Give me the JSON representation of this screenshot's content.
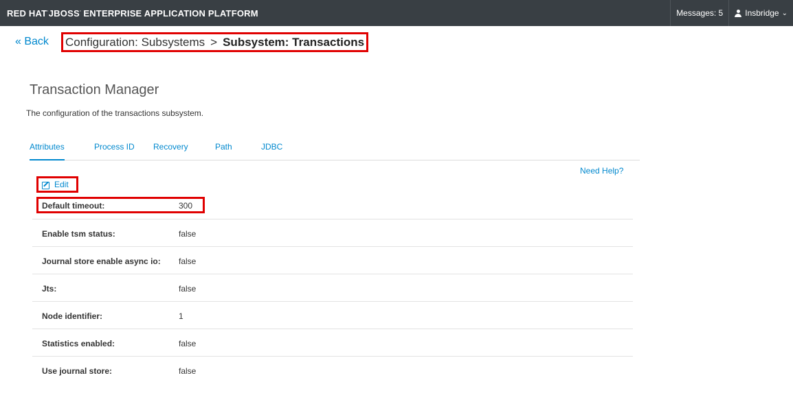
{
  "header": {
    "brand_redhat": "RED HAT",
    "brand_jboss": "JBOSS",
    "brand_rest": "ENTERPRISE APPLICATION PLATFORM",
    "messages": "Messages: 5",
    "user": "Insbridge",
    "user_icon": "user-icon",
    "chevron": "chevron-down-icon"
  },
  "nav": {
    "back": "« Back",
    "breadcrumb_parent": "Configuration: Subsystems",
    "breadcrumb_sep": ">",
    "breadcrumb_current": "Subsystem: Transactions"
  },
  "main": {
    "title": "Transaction Manager",
    "description": "The configuration of the transactions subsystem.",
    "tabs": [
      {
        "label": "Attributes",
        "active": true
      },
      {
        "label": "Process ID",
        "active": false
      },
      {
        "label": "Recovery",
        "active": false
      },
      {
        "label": "Path",
        "active": false
      },
      {
        "label": "JDBC",
        "active": false
      }
    ],
    "need_help": "Need Help?",
    "edit_label": "Edit",
    "edit_icon": "edit-icon",
    "attributes": [
      {
        "label": "Default timeout:",
        "value": "300"
      },
      {
        "label": "Enable tsm status:",
        "value": "false"
      },
      {
        "label": "Journal store enable async io:",
        "value": "false"
      },
      {
        "label": "Jts:",
        "value": "false"
      },
      {
        "label": "Node identifier:",
        "value": "1"
      },
      {
        "label": "Statistics enabled:",
        "value": "false"
      },
      {
        "label": "Use journal store:",
        "value": "false"
      }
    ]
  },
  "colors": {
    "topbar": "#393f44",
    "link": "#0088ce",
    "highlight": "#e00000"
  }
}
